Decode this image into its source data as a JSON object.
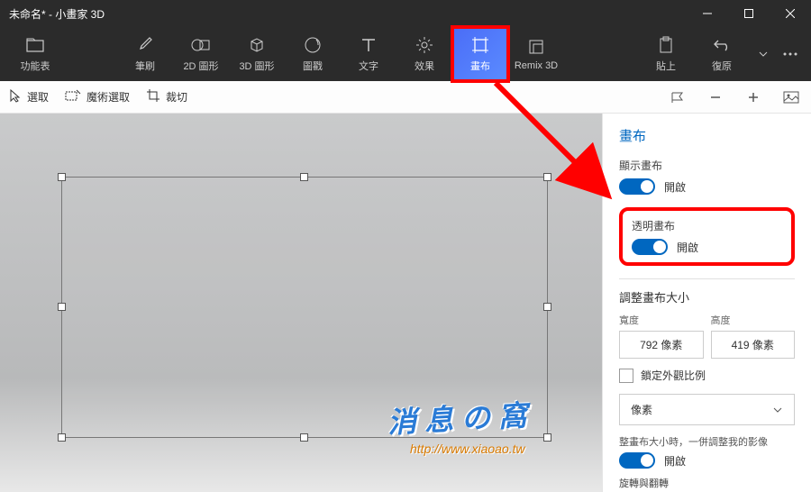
{
  "title": "未命名* - 小畫家 3D",
  "toolbar": {
    "menu": "功能表",
    "brush": "筆刷",
    "shapes2d": "2D 圖形",
    "shapes3d": "3D 圖形",
    "stickers": "圖戳",
    "text": "文字",
    "effects": "效果",
    "canvas": "畫布",
    "remix3d": "Remix 3D",
    "paste": "貼上",
    "undo": "復原"
  },
  "subbar": {
    "select": "選取",
    "magic": "魔術選取",
    "crop": "裁切"
  },
  "panel": {
    "title": "畫布",
    "show_label": "顯示畫布",
    "show_state": "開啟",
    "transparent_label": "透明畫布",
    "transparent_state": "開啟",
    "resize_title": "調整畫布大小",
    "width_label": "寬度",
    "height_label": "高度",
    "width_value": "792 像素",
    "height_value": "419 像素",
    "lock_aspect": "鎖定外觀比例",
    "unit": "像素",
    "resize_note": "整畫布大小時，一併調整我的影像",
    "resize_state": "開啟",
    "flip_label": "旋轉與翻轉"
  },
  "watermark": {
    "text1": "消 息 の 窩",
    "text2": "http://www.xiaoao.tw"
  }
}
